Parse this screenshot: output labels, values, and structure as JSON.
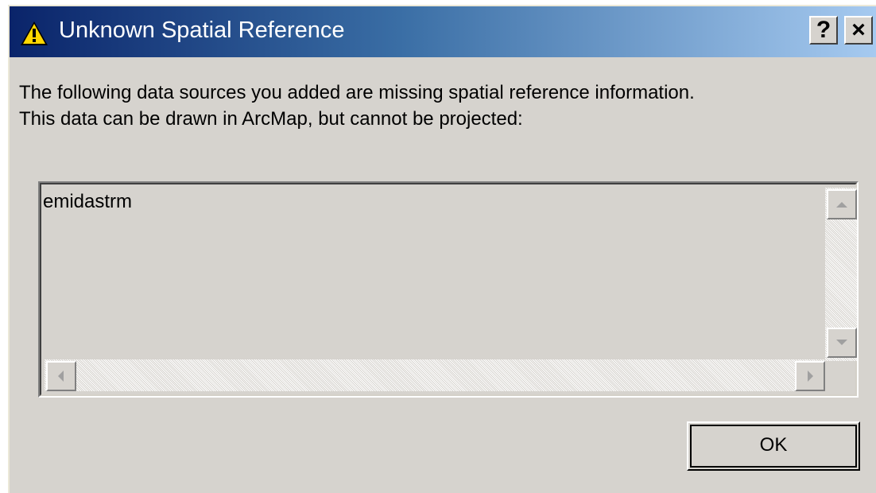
{
  "window": {
    "title": "Unknown Spatial Reference",
    "title_icon": "warning-icon",
    "help_button": "?",
    "close_button": "×"
  },
  "message": {
    "line1": "The following data sources you added are missing spatial reference information.",
    "line2": "This data can be drawn in ArcMap, but cannot be projected:"
  },
  "list": {
    "items": [
      "emidastrm"
    ]
  },
  "buttons": {
    "ok_label": "OK"
  },
  "colors": {
    "titlebar_start": "#0a246a",
    "titlebar_end": "#a6caf0",
    "dialog_face": "#d6d3ce"
  }
}
